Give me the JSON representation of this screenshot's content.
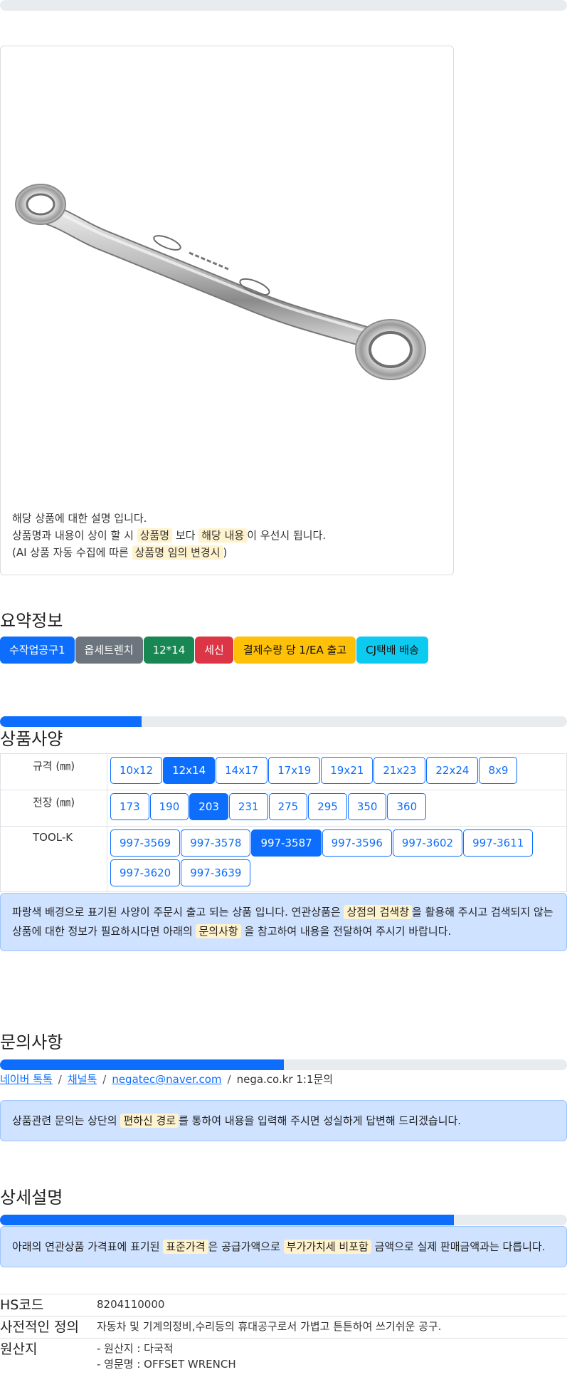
{
  "image_notice": {
    "line1": "해당 상품에 대한 설명 입니다.",
    "line2_a": "상품명과 내용이 상이 할 시",
    "line2_hl1": "상품명",
    "line2_b": "보다",
    "line2_hl2": "해당 내용",
    "line2_c": "이 우선시 됩니다.",
    "line3_a": "(AI 상품 자동 수집에 따른",
    "line3_hl": "상품명 임의 변경시",
    "line3_b": ")"
  },
  "summary": {
    "title": "요약정보",
    "badges": [
      {
        "label": "수작업공구1",
        "color": "#0d6efd"
      },
      {
        "label": "옵세트렌치",
        "color": "#6c757d"
      },
      {
        "label": "12*14",
        "color": "#198754"
      },
      {
        "label": "세신",
        "color": "#dc3545"
      },
      {
        "label": "결제수량 당 1/EA 출고",
        "color": "#ffc107"
      },
      {
        "label": "CJ택배 배송",
        "color": "#0dcaf0"
      }
    ]
  },
  "progress": {
    "spec": 0.25,
    "inquiry": 0.5,
    "detail": 0.8
  },
  "spec": {
    "title": "상품사양",
    "rows": [
      {
        "label": "규격 (㎜)",
        "options": [
          "10x12",
          "12x14",
          "14x17",
          "17x19",
          "19x21",
          "21x23",
          "22x24",
          "8x9"
        ],
        "selected": 1
      },
      {
        "label": "전장 (㎜)",
        "options": [
          "173",
          "190",
          "203",
          "231",
          "275",
          "295",
          "350",
          "360"
        ],
        "selected": 2
      },
      {
        "label": "TOOL-K",
        "options": [
          "997-3569",
          "997-3578",
          "997-3587",
          "997-3596",
          "997-3602",
          "997-3611",
          "997-3620",
          "997-3639"
        ],
        "selected": 2
      }
    ],
    "notice_a": "파랑색 배경으로 표기된 사양이 주문시 출고 되는 상품 입니다. 연관상품은",
    "notice_hl1": "상점의 검색창",
    "notice_b": "을 활용해 주시고 검색되지 않는 상품에 대한 정보가 필요하시다면 아래의",
    "notice_hl2": "문의사항",
    "notice_c": "을 참고하여 내용을 전달하여 주시기 바랍니다."
  },
  "inquiry": {
    "title": "문의사항",
    "links": [
      "네이버 톡톡",
      "채널톡",
      "negatec@naver.com"
    ],
    "sep": "/",
    "plain": "nega.co.kr 1:1문의",
    "notice_a": "상품관련 문의는 상단의",
    "notice_hl": "편하신 경로",
    "notice_b": "를 통하여 내용을 입력해 주시면 성실하게 답변해 드리겠습니다."
  },
  "detail": {
    "title": "상세설명",
    "notice_a": "아래의 연관상품 가격표에 표기된",
    "notice_hl1": "표준가격",
    "notice_b": "은 공급가액으로",
    "notice_hl2": "부가가치세 비포함",
    "notice_c": "금액으로 실제 판매금액과는 다릅니다.",
    "rows": [
      {
        "key": "HS코드",
        "value": "8204110000"
      },
      {
        "key": "사전적인 정의",
        "value": "자동차 및 기계의정비,수리등의 휴대공구로서 가볍고 튼튼하여 쓰기쉬운 공구."
      },
      {
        "key": "원산지",
        "value": "- 원산지 : 다국적",
        "value2": "- 영문명 : OFFSET WRENCH"
      }
    ]
  }
}
